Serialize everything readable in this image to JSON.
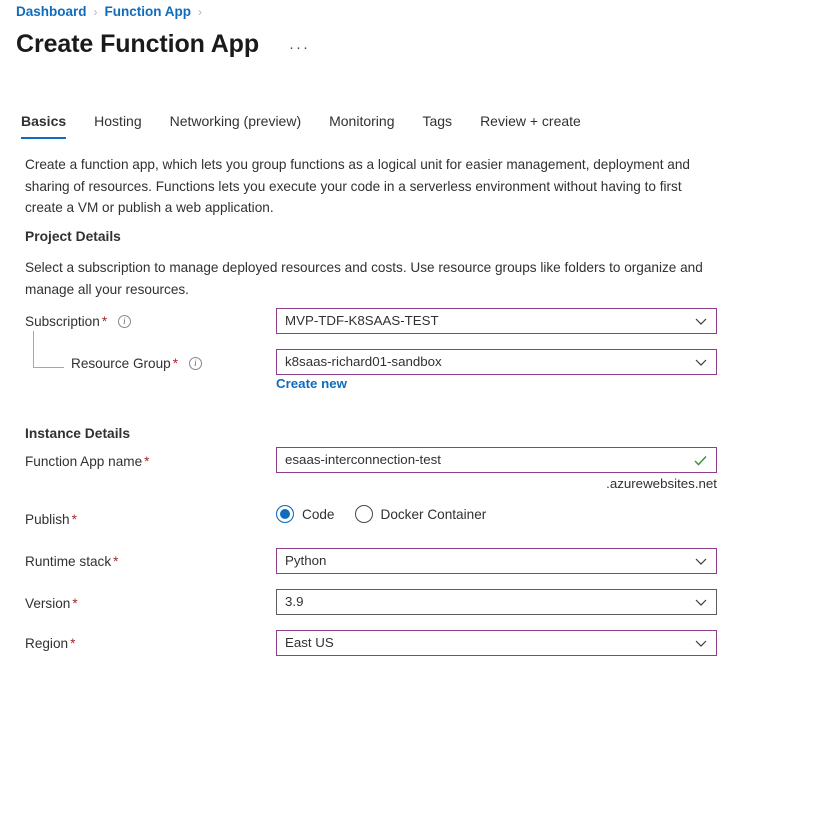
{
  "breadcrumb": {
    "items": [
      {
        "label": "Dashboard"
      },
      {
        "label": "Function App"
      }
    ],
    "separator": "›"
  },
  "header": {
    "title": "Create Function App",
    "ellipsis": "···"
  },
  "tabs": [
    {
      "label": "Basics",
      "active": true
    },
    {
      "label": "Hosting",
      "active": false
    },
    {
      "label": "Networking (preview)",
      "active": false
    },
    {
      "label": "Monitoring",
      "active": false
    },
    {
      "label": "Tags",
      "active": false
    },
    {
      "label": "Review + create",
      "active": false
    }
  ],
  "description": "Create a function app, which lets you group functions as a logical unit for easier management, deployment and sharing of resources. Functions lets you execute your code in a serverless environment without having to first create a VM or publish a web application.",
  "project_details": {
    "heading": "Project Details",
    "description": "Select a subscription to manage deployed resources and costs. Use resource groups like folders to organize and manage all your resources.",
    "subscription": {
      "label": "Subscription",
      "required": "*",
      "value": "MVP-TDF-K8SAAS-TEST",
      "info_icon": "info-icon",
      "chevron_icon": "chevron-down-icon"
    },
    "resource_group": {
      "label": "Resource Group",
      "required": "*",
      "value": "k8saas-richard01-sandbox",
      "info_icon": "info-icon",
      "chevron_icon": "chevron-down-icon",
      "create_new_label": "Create new"
    }
  },
  "instance_details": {
    "heading": "Instance Details",
    "function_app_name": {
      "label": "Function App name",
      "required": "*",
      "value": "esaas-interconnection-test",
      "validation_icon": "checkmark-icon",
      "suffix": ".azurewebsites.net"
    },
    "publish": {
      "label": "Publish",
      "required": "*",
      "options": [
        {
          "label": "Code",
          "selected": true
        },
        {
          "label": "Docker Container",
          "selected": false
        }
      ]
    },
    "runtime_stack": {
      "label": "Runtime stack",
      "required": "*",
      "value": "Python",
      "chevron_icon": "chevron-down-icon"
    },
    "version": {
      "label": "Version",
      "required": "*",
      "value": "3.9",
      "chevron_icon": "chevron-down-icon"
    },
    "region": {
      "label": "Region",
      "required": "*",
      "value": "East US",
      "chevron_icon": "chevron-down-icon"
    }
  },
  "colors": {
    "link": "#0f6cbd",
    "accent": "#0f6cbd",
    "field_border": "#8d3f8d",
    "field_border_inactive": "#605e5c",
    "required_asterisk": "#a4262c",
    "validation_success": "#3a9b35",
    "text": "#323130"
  }
}
